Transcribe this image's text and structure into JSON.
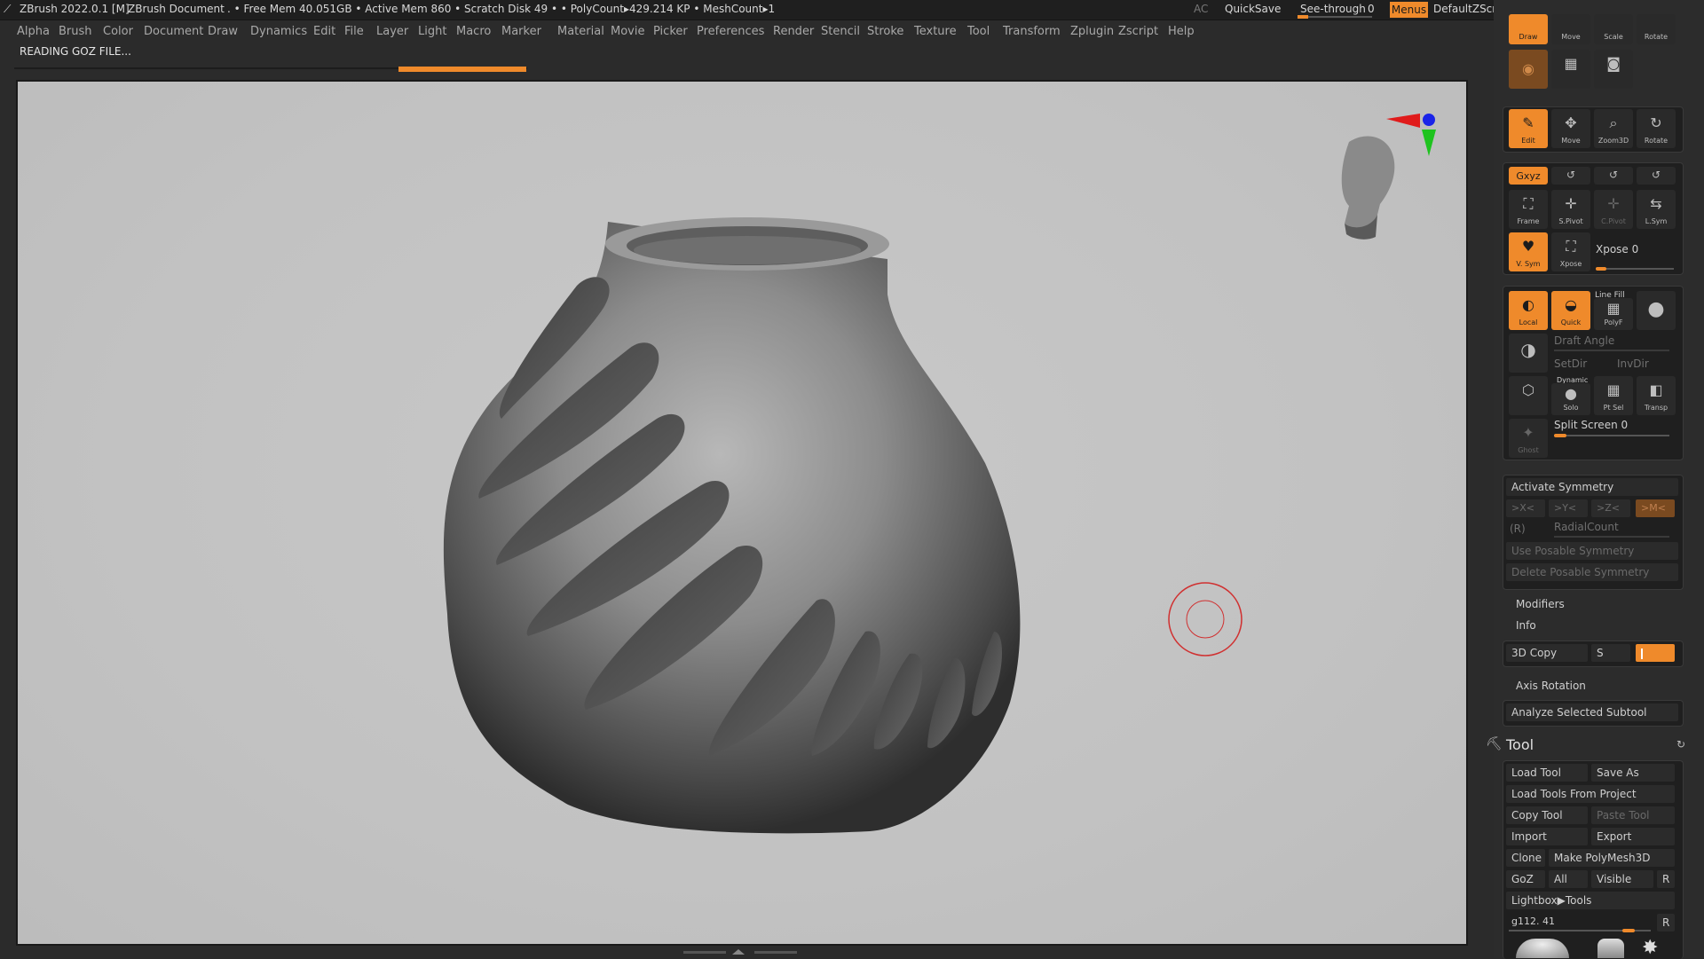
{
  "titlebar": {
    "app_title": "ZBrush 2022.0.1 [M]",
    "document": "ZBrush Document",
    "stats": ". • Free Mem 40.051GB • Active Mem 860 • Scratch Disk 49 • • PolyCount▸429.214 KP • MeshCount▸1",
    "ac": "AC",
    "quicksave": "QuickSave",
    "seethrough_label": "See-through",
    "seethrough_value": "0",
    "menus": "Menus",
    "script": "DefaultZScript"
  },
  "menubar": [
    "Alpha",
    "Brush",
    "Color",
    "Document",
    "Draw",
    "Dynamics",
    "Edit",
    "File",
    "Layer",
    "Light",
    "Macro",
    "Marker",
    "Material",
    "Movie",
    "Picker",
    "Preferences",
    "Render",
    "Stencil",
    "Stroke",
    "Texture",
    "Tool",
    "Transform",
    "Zplugin",
    "Zscript",
    "Help"
  ],
  "status": {
    "message": "READING GOZ FILE..."
  },
  "top_tools": {
    "draw": "Draw",
    "move": "Move",
    "scale": "Scale",
    "rotate": "Rotate"
  },
  "transform_tools": {
    "edit": "Edit",
    "move": "Move",
    "zoom3d": "Zoom3D",
    "rotate": "Rotate"
  },
  "symmetry_tools": {
    "xyz": "Gxyz",
    "frame": "Frame",
    "spivot": "S.Pivot",
    "cpivot": "C.Pivot",
    "lsym": "L.Sym",
    "vsym": "V. Sym",
    "xpose": "Xpose",
    "xpose_label": "Xpose 0"
  },
  "render_tools": {
    "local": "Local",
    "quick": "Quick",
    "linefill": "Line Fill",
    "polyf": "PolyF",
    "draft_angle": "Draft Angle",
    "setdir": "SetDir",
    "invdir": "InvDir",
    "dynamic": "Dynamic",
    "solo": "Solo",
    "ptsel": "Pt Sel",
    "transp": "Transp",
    "ghost": "Ghost",
    "split_screen": "Split Screen 0"
  },
  "symmetry_panel": {
    "activate": "Activate Symmetry",
    "axes": [
      ">X<",
      ">Y<",
      ">Z<",
      ">M<"
    ],
    "r": "(R)",
    "radialcount": "RadialCount",
    "use_posable": "Use Posable Symmetry",
    "delete_posable": "Delete Posable Symmetry"
  },
  "sections": {
    "modifiers": "Modifiers",
    "info": "Info",
    "copy3d": "3D Copy",
    "s": "S",
    "axis_rotation": "Axis Rotation",
    "analyze": "Analyze Selected Subtool"
  },
  "tool_palette": {
    "title": "Tool",
    "load_tool": "Load Tool",
    "save_as": "Save As",
    "load_project": "Load Tools From Project",
    "copy_tool": "Copy Tool",
    "paste_tool": "Paste Tool",
    "import": "Import",
    "export": "Export",
    "clone": "Clone",
    "make_polymesh": "Make PolyMesh3D",
    "goz": "GoZ",
    "all": "All",
    "visible": "Visible",
    "r": "R",
    "lightbox": "Lightbox▶Tools",
    "current_tool": "g112. 41",
    "r2": "R"
  },
  "colors": {
    "accent": "#ef8a2b",
    "viewport_bg": "#c3c3c3",
    "panel": "#2c2c2c"
  }
}
